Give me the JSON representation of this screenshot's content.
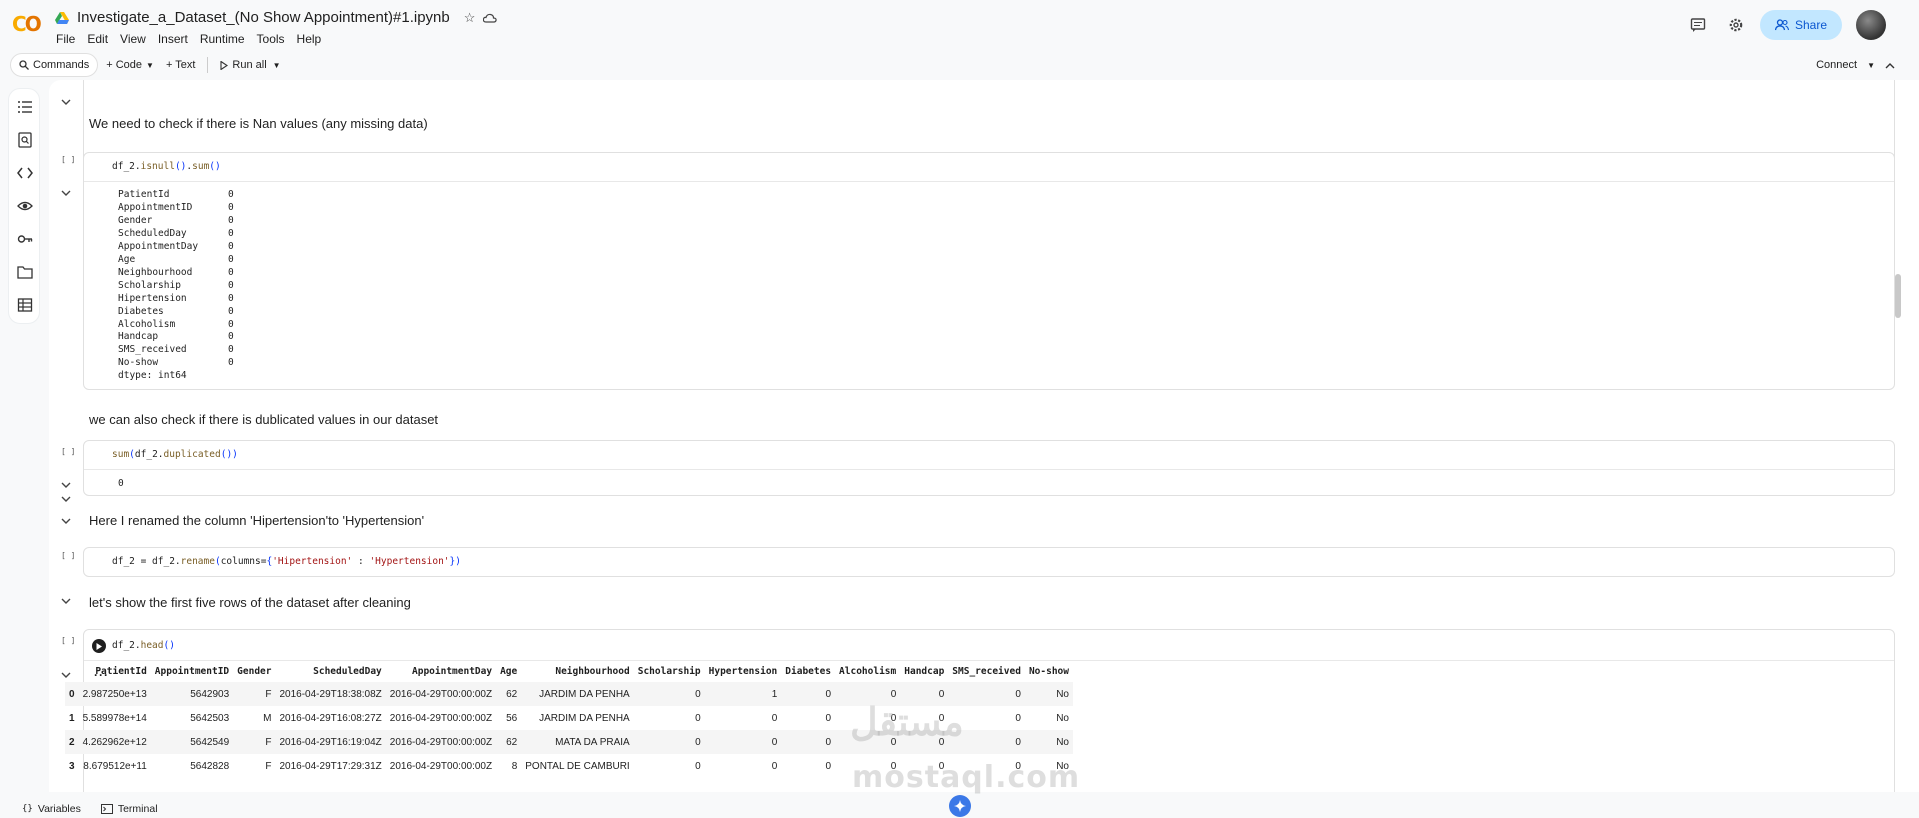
{
  "app": {
    "logo": "CO",
    "title": "Investigate_a_Dataset_(No Show Appointment)#1.ipynb"
  },
  "menu": [
    "File",
    "Edit",
    "View",
    "Insert",
    "Runtime",
    "Tools",
    "Help"
  ],
  "share_label": "Share",
  "toolbar": {
    "commands": "Commands",
    "code": "+ Code",
    "text": "+ Text",
    "run_all": "Run all",
    "connect": "Connect"
  },
  "cells": {
    "md1": "We need to check if there is Nan values (any missing data)",
    "code1": "df_2.isnull().sum()",
    "out1": [
      [
        "PatientId",
        "0"
      ],
      [
        "AppointmentID",
        "0"
      ],
      [
        "Gender",
        "0"
      ],
      [
        "ScheduledDay",
        "0"
      ],
      [
        "AppointmentDay",
        "0"
      ],
      [
        "Age",
        "0"
      ],
      [
        "Neighbourhood",
        "0"
      ],
      [
        "Scholarship",
        "0"
      ],
      [
        "Hipertension",
        "0"
      ],
      [
        "Diabetes",
        "0"
      ],
      [
        "Alcoholism",
        "0"
      ],
      [
        "Handcap",
        "0"
      ],
      [
        "SMS_received",
        "0"
      ],
      [
        "No-show",
        "0"
      ]
    ],
    "out1_dtype": "dtype: int64",
    "md2": "we can also check if there is dublicated values in our dataset",
    "code2": "sum(df_2.duplicated())",
    "out2": "0",
    "md3": "Here I renamed the column 'Hipertension'to 'Hypertension'",
    "code3": "df_2 = df_2.rename(columns={'Hipertension' : 'Hypertension'})",
    "md4": "let's show the first five rows of the dataset after cleaning",
    "code4": "df_2.head()",
    "bracket": "[ ]"
  },
  "table": {
    "headers": [
      "",
      "PatientId",
      "AppointmentID",
      "Gender",
      "ScheduledDay",
      "AppointmentDay",
      "Age",
      "Neighbourhood",
      "Scholarship",
      "Hypertension",
      "Diabetes",
      "Alcoholism",
      "Handcap",
      "SMS_received",
      "No-show"
    ],
    "rows": [
      [
        "0",
        "2.987250e+13",
        "5642903",
        "F",
        "2016-04-29T18:38:08Z",
        "2016-04-29T00:00:00Z",
        "62",
        "JARDIM DA PENHA",
        "0",
        "1",
        "0",
        "0",
        "0",
        "0",
        "No"
      ],
      [
        "1",
        "5.589978e+14",
        "5642503",
        "M",
        "2016-04-29T16:08:27Z",
        "2016-04-29T00:00:00Z",
        "56",
        "JARDIM DA PENHA",
        "0",
        "0",
        "0",
        "0",
        "0",
        "0",
        "No"
      ],
      [
        "2",
        "4.262962e+12",
        "5642549",
        "F",
        "2016-04-29T16:19:04Z",
        "2016-04-29T00:00:00Z",
        "62",
        "MATA DA PRAIA",
        "0",
        "0",
        "0",
        "0",
        "0",
        "0",
        "No"
      ],
      [
        "3",
        "8.679512e+11",
        "5642828",
        "F",
        "2016-04-29T17:29:31Z",
        "2016-04-29T00:00:00Z",
        "8",
        "PONTAL DE CAMBURI",
        "0",
        "0",
        "0",
        "0",
        "0",
        "0",
        "No"
      ]
    ]
  },
  "bottom": {
    "variables": "Variables",
    "terminal": "Terminal"
  },
  "watermark": {
    "arabic": "مستقل",
    "latin": "mostaql.com"
  }
}
